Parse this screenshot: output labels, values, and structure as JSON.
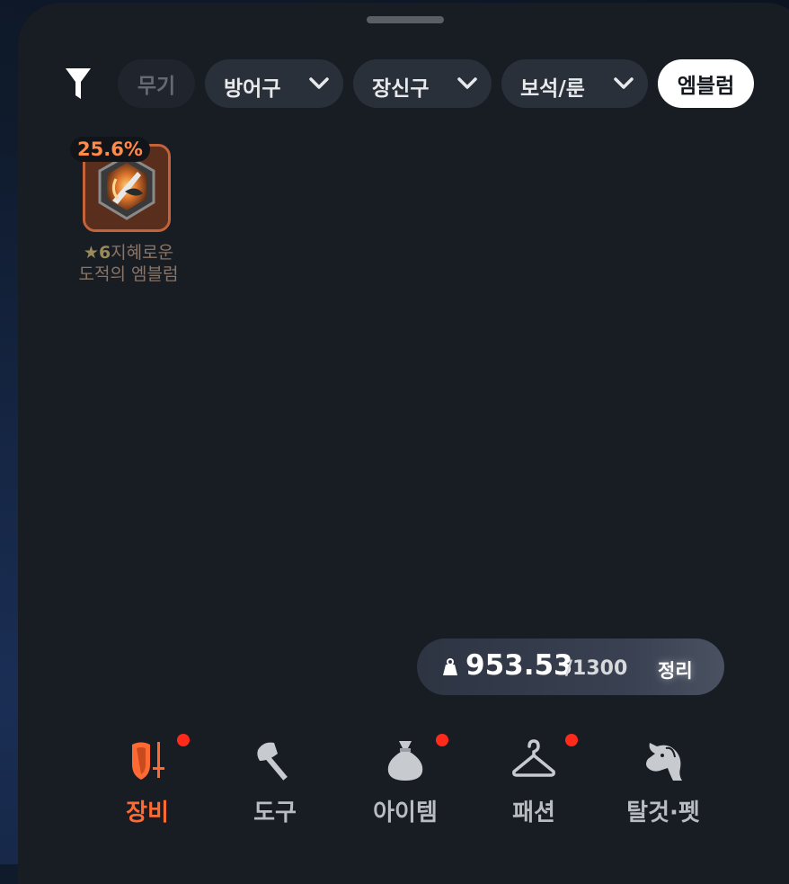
{
  "filters": {
    "chips": [
      {
        "label": "무기",
        "state": "disabled"
      },
      {
        "label": "방어구",
        "has_dropdown": true
      },
      {
        "label": "장신구",
        "has_dropdown": true
      },
      {
        "label": "보석/룬",
        "has_dropdown": true
      },
      {
        "label": "엠블럼",
        "state": "selected"
      }
    ]
  },
  "items": [
    {
      "percent": "25.6%",
      "star": "★6",
      "name_line1": "지혜로운",
      "name_line2": "도적의 엠블럼",
      "icon": "emblem-icon"
    }
  ],
  "weight": {
    "current": "953.53",
    "max": "/1300",
    "sort_label": "정리"
  },
  "nav": {
    "items": [
      {
        "label": "장비",
        "icon": "shield-sword-icon",
        "active": true,
        "badge": true
      },
      {
        "label": "도구",
        "icon": "axe-icon",
        "badge": false
      },
      {
        "label": "아이템",
        "icon": "bag-icon",
        "badge": true
      },
      {
        "label": "패션",
        "icon": "hanger-icon",
        "badge": true
      },
      {
        "label": "탈것·펫",
        "icon": "horse-icon",
        "badge": false
      }
    ]
  },
  "colors": {
    "accent": "#ff6a33",
    "badge": "#ff2a1a",
    "sheet_bg": "#181d24",
    "chip_bg": "#2a303a"
  }
}
